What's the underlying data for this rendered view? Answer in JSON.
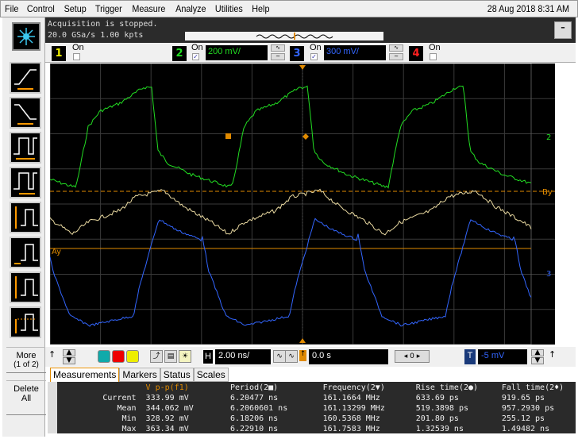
{
  "menu": {
    "items": [
      "File",
      "Control",
      "Setup",
      "Trigger",
      "Measure",
      "Analyze",
      "Utilities",
      "Help"
    ],
    "datetime": "28 Aug 2018  8:31 AM"
  },
  "status": {
    "line1": "Acquisition is stopped.",
    "line2": "20.0 GSa/s   1.00 kpts",
    "minimize": "–"
  },
  "channels": [
    {
      "num": "1",
      "on_label": "On",
      "checked": false,
      "color": "#f0f000"
    },
    {
      "num": "2",
      "on_label": "On",
      "checked": true,
      "scale": "200 mV/",
      "color": "#22dd22"
    },
    {
      "num": "3",
      "on_label": "On",
      "checked": true,
      "scale": "300 mV/",
      "color": "#3366ff"
    },
    {
      "num": "4",
      "on_label": "On",
      "checked": false,
      "color": "#ff2020"
    }
  ],
  "plot_labels": {
    "ch2": "2",
    "ch3": "3",
    "by": "By",
    "ay": "Ay"
  },
  "sidebar": {
    "more": "More",
    "more_sub": "(1 of 2)",
    "delete": "Delete",
    "delete_sub": "All"
  },
  "controls": {
    "timebase": "2.00 ns/",
    "h_label": "H",
    "delay": "0.0 s",
    "zero": "0",
    "t_label": "T",
    "trigger_level": "-5 mV"
  },
  "tabs": [
    "Measurements",
    "Markers",
    "Status",
    "Scales"
  ],
  "measurements": {
    "headers": [
      "",
      "V p-p(f1)",
      "Period(2■)",
      "Frequency(2▼)",
      "Rise time(2●)",
      "Fall time(2♦)"
    ],
    "rows": [
      [
        "Current",
        "333.99 mV",
        "6.20477 ns",
        "161.1664 MHz",
        "633.69 ps",
        "919.65 ps"
      ],
      [
        "Mean",
        "344.062 mV",
        "6.2060601 ns",
        "161.13299 MHz",
        "519.3898 ps",
        "957.2930 ps"
      ],
      [
        "Min",
        "328.92 mV",
        "6.18206 ns",
        "160.5368 MHz",
        "201.80 ps",
        "255.12 ps"
      ],
      [
        "Max",
        "363.34 mV",
        "6.22910 ns",
        "161.7583 MHz",
        "1.32539 ns",
        "1.49482 ns"
      ]
    ]
  },
  "colors": {
    "ch1": "#f0f000",
    "ch2": "#22dd22",
    "ch3": "#3366ff",
    "ch4": "#ff2020",
    "math": "#e8d8a0",
    "marker": "#e08a00"
  }
}
